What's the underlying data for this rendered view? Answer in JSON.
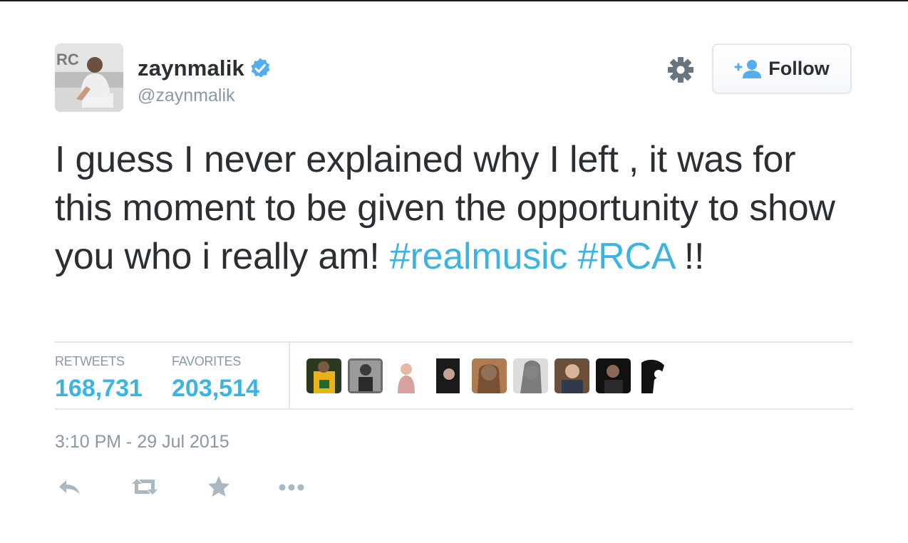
{
  "user": {
    "display_name": "zaynmalik",
    "handle": "@zaynmalik",
    "verified": true,
    "avatar_icon": "profile-photo"
  },
  "header": {
    "settings_icon": "gear-icon",
    "follow_label": "Follow",
    "follow_icon": "add-user-icon"
  },
  "tweet": {
    "text_plain": "I guess I never explained why I left , it was for this moment to be given the opportunity to show you who i really am! ",
    "hashtag_1": "#realmusic",
    "hashtag_2": "#RCA",
    "text_end": " !!"
  },
  "stats": {
    "retweets_label": "RETWEETS",
    "retweets_value": "168,731",
    "favorites_label": "FAVORITES",
    "favorites_value": "203,514"
  },
  "favoriters_count_shown": 9,
  "timestamp": "3:10 PM - 29 Jul 2015",
  "actions": [
    "reply-icon",
    "retweet-icon",
    "favorite-icon",
    "more-icon"
  ],
  "colors": {
    "text": "#292f33",
    "muted": "#8899a6",
    "link": "#3bb4e3",
    "border": "#e1e8ed",
    "verified": "#55acee"
  }
}
